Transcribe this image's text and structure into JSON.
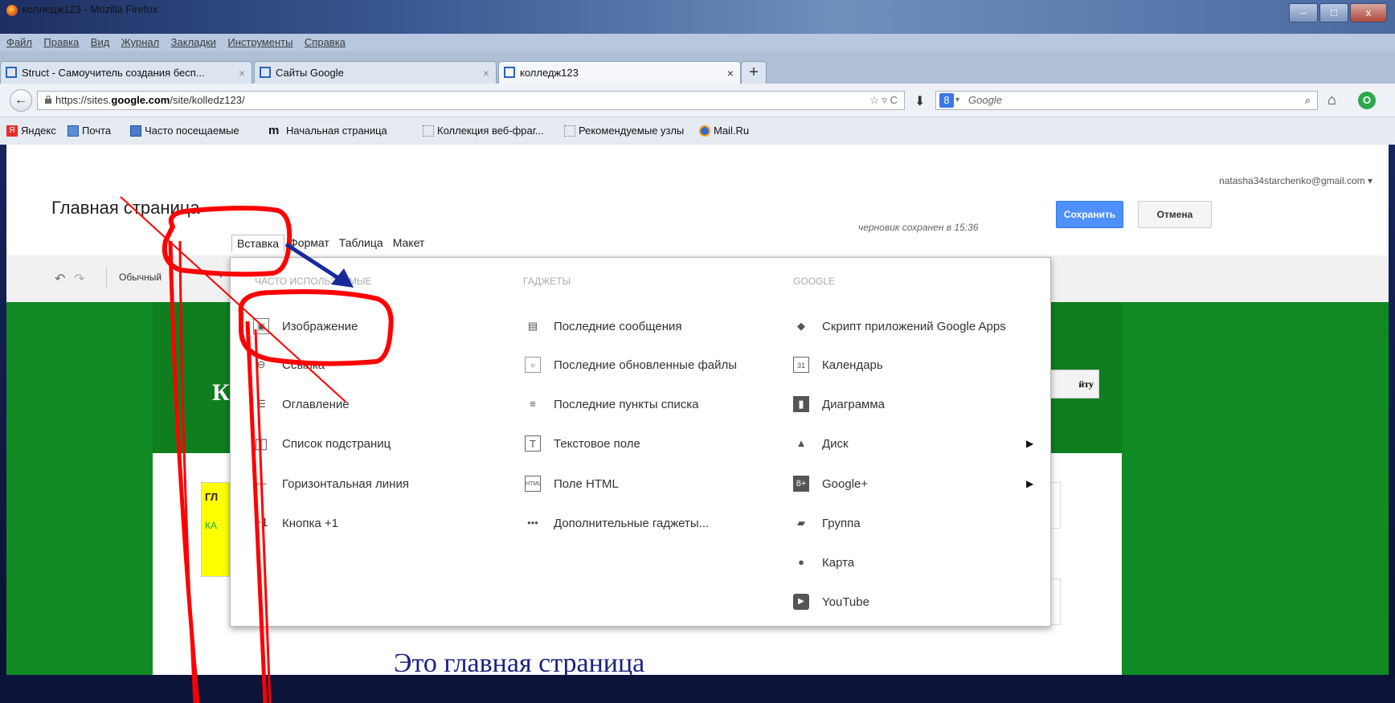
{
  "window": {
    "title": "колледж123 - Mozilla Firefox",
    "minimize": "–",
    "maximize": "□",
    "close": "x"
  },
  "menubar": [
    "Файл",
    "Правка",
    "Вид",
    "Журнал",
    "Закладки",
    "Инструменты",
    "Справка"
  ],
  "tabs": [
    {
      "label": "Struct - Самоучитель создания бесп...",
      "close": "×"
    },
    {
      "label": "Сайты Google",
      "close": "×"
    },
    {
      "label": "колледж123",
      "close": "×"
    }
  ],
  "newtab": "+",
  "nav": {
    "back": "←",
    "url_prefix": "https://sites.",
    "url_bold": "google.com",
    "url_suffix": "/site/kolledz123/",
    "url_right": "☆ ▿ C",
    "download": "⬇",
    "search_engine": "8",
    "search_caret": "▾",
    "search_placeholder": "Google",
    "search_icon": "⌕",
    "home": "⌂",
    "addon": "O"
  },
  "bookmarks": [
    "Яндекс",
    "Почта",
    "Часто посещаемые",
    "Начальная страница",
    "Коллекция веб-фраг...",
    "Рекомендуемые узлы",
    "Mail.Ru"
  ],
  "page": {
    "account": "natasha34starchenko@gmail.com ▾",
    "title": "Главная страница",
    "draft": "черновик сохранен в 15:36",
    "save": "Сохранить",
    "cancel": "Отмена",
    "menus": [
      "Вставка",
      "Формат",
      "Таблица",
      "Макет"
    ],
    "style_select": "Обычный",
    "site_name_visible": "К",
    "share_visible": "йту",
    "yellow_line1": "ГЛ",
    "yellow_line2": "КА",
    "heading_peek": "Это главная страница"
  },
  "insert_menu": {
    "columns": [
      {
        "header": "ЧАСТО ИСПОЛЬЗУЕМЫЕ",
        "items": [
          {
            "label": "Изображение",
            "icon": "image-icon",
            "glyph": "▣"
          },
          {
            "label": "Ссылка",
            "icon": "link-icon",
            "glyph": "⊖"
          },
          {
            "label": "Оглавление",
            "icon": "toc-icon",
            "glyph": "☰"
          },
          {
            "label": "Список подстраниц",
            "icon": "subpages-icon",
            "glyph": "◫"
          },
          {
            "label": "Горизонтальная линия",
            "icon": "hline-icon",
            "glyph": "—"
          },
          {
            "label": "Кнопка +1",
            "icon": "plusone-icon",
            "glyph": "+1"
          }
        ]
      },
      {
        "header": "ГАДЖЕТЫ",
        "items": [
          {
            "label": "Последние сообщения",
            "icon": "recent-posts-icon",
            "glyph": "▤"
          },
          {
            "label": "Последние обновленные файлы",
            "icon": "recent-files-icon",
            "glyph": "▫"
          },
          {
            "label": "Последние пункты списка",
            "icon": "recent-list-icon",
            "glyph": "≡"
          },
          {
            "label": "Текстовое поле",
            "icon": "textbox-icon",
            "glyph": "T"
          },
          {
            "label": "Поле HTML",
            "icon": "html-icon",
            "glyph": "HTML"
          },
          {
            "label": "Дополнительные гаджеты...",
            "icon": "more-icon",
            "glyph": "•••"
          }
        ]
      },
      {
        "header": "GOOGLE",
        "items": [
          {
            "label": "Скрипт приложений Google Apps",
            "icon": "apps-script-icon",
            "glyph": "◆"
          },
          {
            "label": "Календарь",
            "icon": "calendar-icon",
            "glyph": "31"
          },
          {
            "label": "Диаграмма",
            "icon": "chart-icon",
            "glyph": "▮"
          },
          {
            "label": "Диск",
            "icon": "drive-icon",
            "glyph": "▲",
            "arrow": "▶"
          },
          {
            "label": "Google+",
            "icon": "gplus-icon",
            "glyph": "8+",
            "arrow": "▶"
          },
          {
            "label": "Группа",
            "icon": "group-icon",
            "glyph": "▰"
          },
          {
            "label": "Карта",
            "icon": "map-pin-icon",
            "glyph": "●"
          },
          {
            "label": "YouTube",
            "icon": "youtube-icon",
            "glyph": "▶"
          }
        ]
      }
    ]
  },
  "colors": {
    "accent_save": "#4d90fe",
    "site_green": "#118a24",
    "annotation_red": "#ff0000",
    "annotation_blue": "#1a2a9a"
  }
}
